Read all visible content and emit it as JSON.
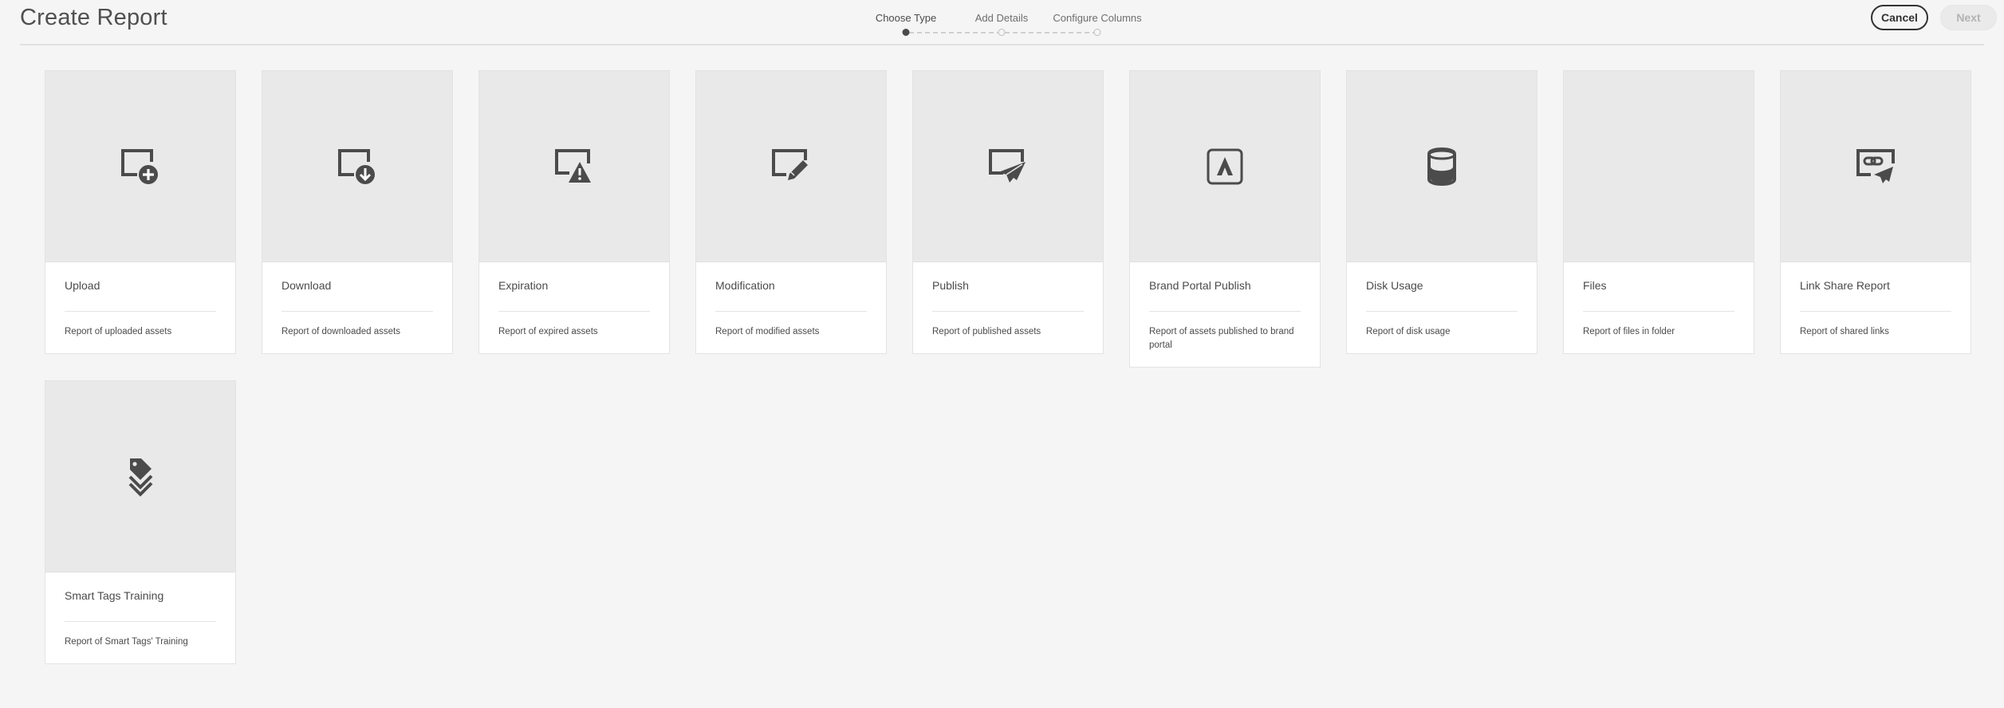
{
  "header": {
    "title": "Create Report",
    "cancel_label": "Cancel",
    "next_label": "Next"
  },
  "wizard": {
    "steps": [
      {
        "label": "Choose Type",
        "active": true
      },
      {
        "label": "Add Details",
        "active": false
      },
      {
        "label": "Configure Columns",
        "active": false
      }
    ]
  },
  "colors": {
    "background": "#f5f5f5",
    "thumb": "#e9e9e9",
    "icon": "#4b4b4b",
    "text": "#4b4b4b",
    "next_disabled": "#b3b3b3"
  },
  "cards": [
    {
      "title": "Upload",
      "description": "Report of uploaded assets",
      "icon": "upload-icon"
    },
    {
      "title": "Download",
      "description": "Report of downloaded assets",
      "icon": "download-icon"
    },
    {
      "title": "Expiration",
      "description": "Report of expired assets",
      "icon": "expiration-icon"
    },
    {
      "title": "Modification",
      "description": "Report of modified assets",
      "icon": "modification-icon"
    },
    {
      "title": "Publish",
      "description": "Report of published assets",
      "icon": "publish-icon"
    },
    {
      "title": "Brand Portal Publish",
      "description": "Report of assets published to brand portal",
      "icon": "brand-portal-icon"
    },
    {
      "title": "Disk Usage",
      "description": "Report of disk usage",
      "icon": "disk-usage-icon"
    },
    {
      "title": "Files",
      "description": "Report of files in folder",
      "icon": "files-icon"
    },
    {
      "title": "Link Share Report",
      "description": "Report of shared links",
      "icon": "link-share-icon"
    },
    {
      "title": "Smart Tags Training",
      "description": "Report of Smart Tags' Training",
      "icon": "smart-tags-icon"
    }
  ]
}
